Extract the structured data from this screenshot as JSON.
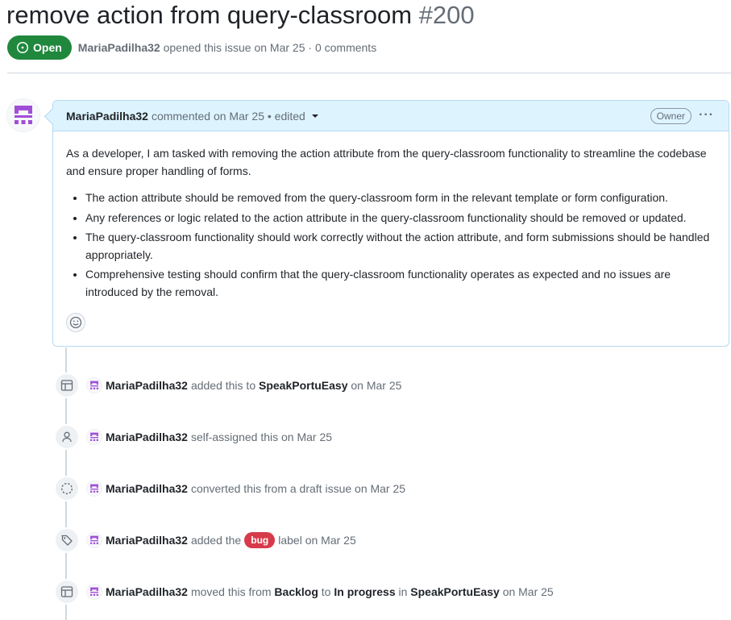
{
  "issue": {
    "title": "remove action from query-classroom",
    "number": "#200",
    "state": "Open",
    "author": "MariaPadilha32",
    "opened_text": "opened this issue on Mar 25 · 0 comments"
  },
  "comment": {
    "author": "MariaPadilha32",
    "meta": "commented on Mar 25 • edited",
    "badge": "Owner",
    "menu": "···",
    "intro": "As a developer, I am tasked with removing the action attribute from the query-classroom functionality to streamline the codebase and ensure proper handling of forms.",
    "bullets": [
      "The action attribute should be removed from the query-classroom form in the relevant template or form configuration.",
      "Any references or logic related to the action attribute in the query-classroom functionality should be removed or updated.",
      "The query-classroom functionality should work correctly without the action attribute, and form submissions should be handled appropriately.",
      "Comprehensive testing should confirm that the query-classroom functionality operates as expected and no issues are introduced by the removal."
    ]
  },
  "events": [
    {
      "icon": "project-table-icon",
      "user": "MariaPadilha32",
      "t1": "added this to",
      "project": "SpeakPortuEasy",
      "t2": "on Mar 25"
    },
    {
      "icon": "person-icon",
      "user": "MariaPadilha32",
      "t1": "self-assigned this on Mar 25"
    },
    {
      "icon": "dashed-circle-icon",
      "user": "MariaPadilha32",
      "t1": "converted this from a draft issue on Mar 25"
    },
    {
      "icon": "tag-icon",
      "user": "MariaPadilha32",
      "t1": "added the",
      "label": "bug",
      "t2": "label on Mar 25"
    },
    {
      "icon": "project-table-icon",
      "user": "MariaPadilha32",
      "t1": "moved this from",
      "from": "Backlog",
      "mid": "to",
      "to": "In progress",
      "mid2": "in",
      "project": "SpeakPortuEasy",
      "t2": "on Mar 25"
    }
  ],
  "colors": {
    "open_green": "#1f883d",
    "bug_red": "#d73a4a",
    "avatar_purple": "#a14ed6",
    "header_blue": "#ddf4ff"
  }
}
